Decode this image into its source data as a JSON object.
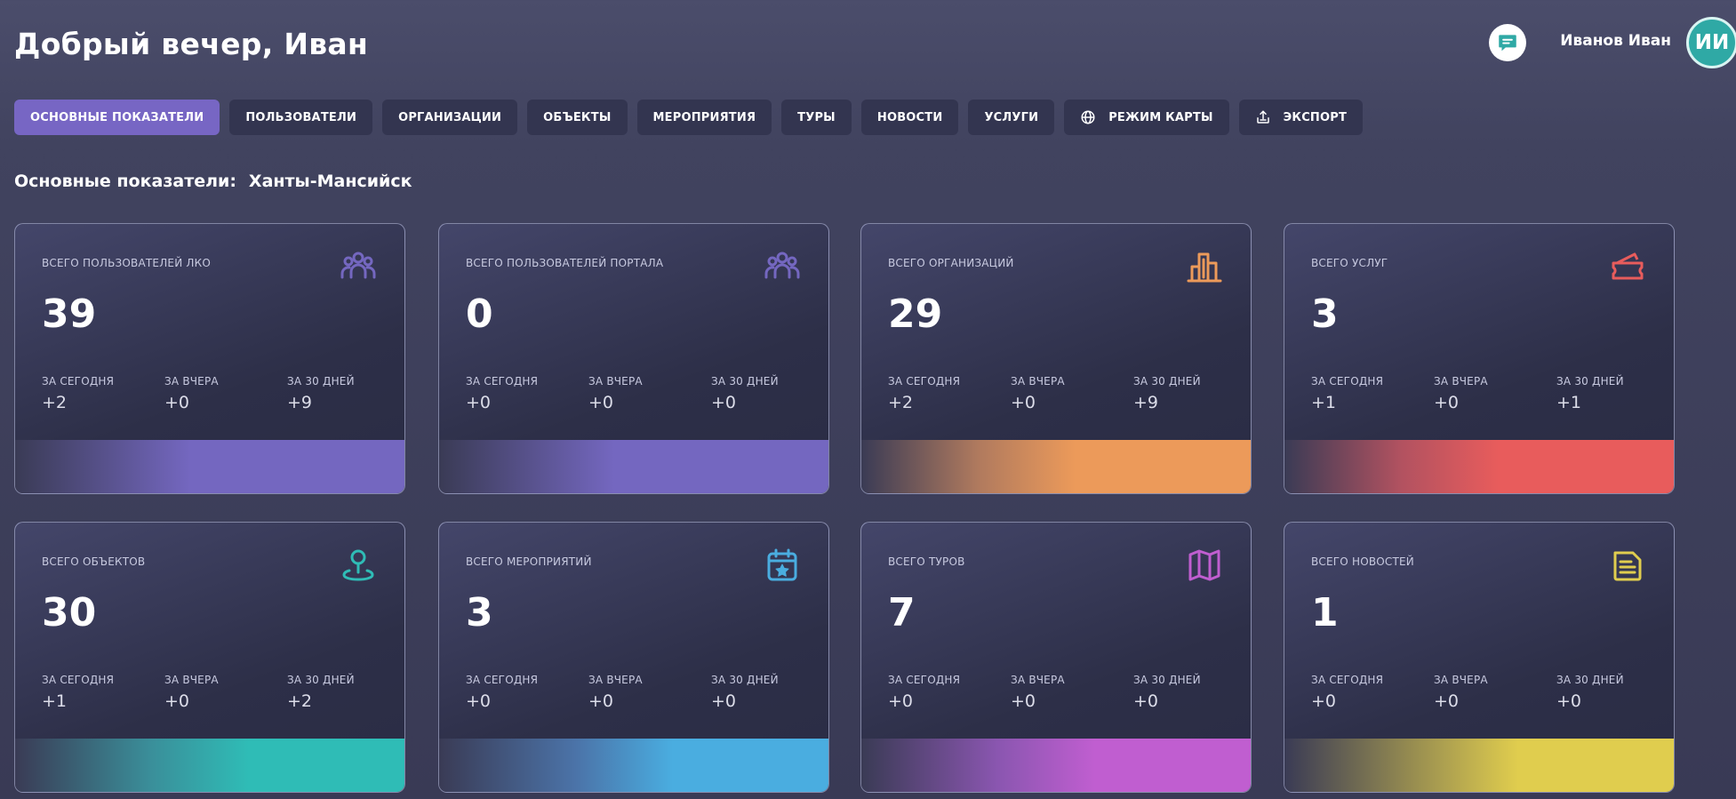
{
  "header": {
    "greeting": "Добрый вечер, Иван",
    "chat_icon": "chat-bubble-icon",
    "user_name": "Иванов Иван",
    "avatar_initials": "ИИ"
  },
  "tabs": [
    {
      "label": "ОСНОВНЫЕ ПОКАЗАТЕЛИ",
      "active": true
    },
    {
      "label": "ПОЛЬЗОВАТЕЛИ"
    },
    {
      "label": "ОРГАНИЗАЦИИ"
    },
    {
      "label": "ОБЪЕКТЫ"
    },
    {
      "label": "МЕРОПРИЯТИЯ"
    },
    {
      "label": "ТУРЫ"
    },
    {
      "label": "НОВОСТИ"
    },
    {
      "label": "УСЛУГИ"
    },
    {
      "label": "РЕЖИМ КАРТЫ",
      "icon": "globe-icon"
    },
    {
      "label": "ЭКСПОРТ",
      "icon": "export-icon"
    }
  ],
  "section": {
    "title": "Основные показатели:",
    "city": "Ханты-Мансийск"
  },
  "stat_labels": {
    "today": "ЗА СЕГОДНЯ",
    "yesterday": "ЗА ВЧЕРА",
    "month": "ЗА 30 ДНЕЙ"
  },
  "cards": [
    {
      "label": "ВСЕГО ПОЛЬЗОВАТЕЛЕЙ ЛКО",
      "value": "39",
      "today": "+2",
      "yesterday": "+0",
      "month": "+9",
      "icon": "users-group-icon",
      "color": "#7467c0"
    },
    {
      "label": "ВСЕГО ПОЛЬЗОВАТЕЛЕЙ ПОРТАЛА",
      "value": "0",
      "today": "+0",
      "yesterday": "+0",
      "month": "+0",
      "icon": "users-group-icon",
      "color": "#7467c0"
    },
    {
      "label": "ВСЕГО ОРГАНИЗАЦИЙ",
      "value": "29",
      "today": "+2",
      "yesterday": "+0",
      "month": "+9",
      "icon": "buildings-icon",
      "color": "#ec9a5a"
    },
    {
      "label": "ВСЕГО УСЛУГ",
      "value": "3",
      "today": "+1",
      "yesterday": "+0",
      "month": "+1",
      "icon": "ticket-icon",
      "color": "#e85c5c"
    },
    {
      "label": "ВСЕГО ОБЪЕКТОВ",
      "value": "30",
      "today": "+1",
      "yesterday": "+0",
      "month": "+2",
      "icon": "map-pin-icon",
      "color": "#2fbcb6"
    },
    {
      "label": "ВСЕГО МЕРОПРИЯТИЙ",
      "value": "3",
      "today": "+0",
      "yesterday": "+0",
      "month": "+0",
      "icon": "calendar-star-icon",
      "color": "#4aade0"
    },
    {
      "label": "ВСЕГО ТУРОВ",
      "value": "7",
      "today": "+0",
      "yesterday": "+0",
      "month": "+0",
      "icon": "map-icon",
      "color": "#c05ed0"
    },
    {
      "label": "ВСЕГО НОВОСТЕЙ",
      "value": "1",
      "today": "+0",
      "yesterday": "+0",
      "month": "+0",
      "icon": "news-icon",
      "color": "#e0cd4e"
    }
  ]
}
